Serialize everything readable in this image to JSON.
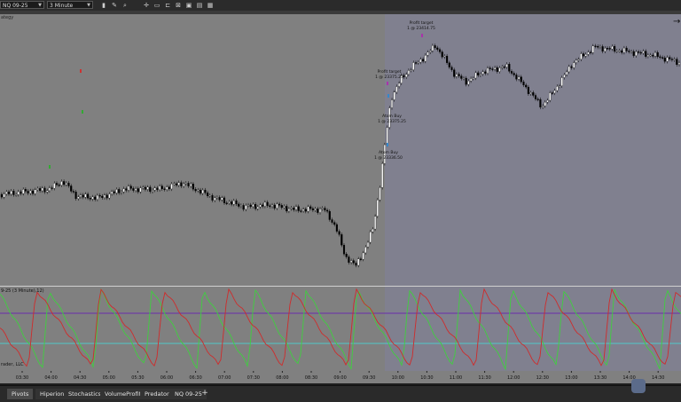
{
  "toolbar": {
    "instrument": "NQ 09-25",
    "interval": "3 Minute",
    "icons": [
      "bars-icon",
      "pencil-icon",
      "zoom-icon",
      "crosshair-icon",
      "draw-object-icon",
      "properties-icon",
      "layout-icon",
      "snapshot-icon",
      "calendar-icon",
      "data-box-icon"
    ]
  },
  "chart": {
    "strategy_label": "ategy",
    "indicator_label": "9-25 (3 Minute),12)",
    "copyright": "rader, LLC",
    "arrow_glyph": "→",
    "time_labels": [
      "03:30",
      "04:00",
      "04:30",
      "05:00",
      "05:30",
      "06:00",
      "06:30",
      "07:00",
      "07:30",
      "08:00",
      "08:30",
      "09:00",
      "09:30",
      "10:00",
      "10:30",
      "11:00",
      "11:30",
      "12:00",
      "12:30",
      "13:00",
      "13:30",
      "14:00",
      "14:30"
    ],
    "annotations": [
      {
        "name": "profit-target-1",
        "line1": "Profit target",
        "line2": "1 @ 23414.75"
      },
      {
        "name": "profit-target-2",
        "line1": "Profit target",
        "line2": "1 @ 23375.25"
      },
      {
        "name": "atom-buy-1",
        "line1": "Atom Buy",
        "line2": "1 @ 23375.25"
      },
      {
        "name": "atom-buy-2",
        "line1": "Atom Buy",
        "line2": "1 @ 23336.50"
      }
    ],
    "colors": {
      "bg_left": "#808080",
      "bg_right": "#80808f",
      "up": "#ffffff",
      "down": "#000000",
      "green": "#3fcf3f",
      "red": "#cf2b2b",
      "purple": "#6a2bab",
      "cyan": "#4fc9c9"
    }
  },
  "tabs": [
    "Pivots",
    "Hiperion",
    "Stochastics",
    "VolumeProfit",
    "Predator",
    "NQ 09-25"
  ],
  "tab_add": "+"
}
